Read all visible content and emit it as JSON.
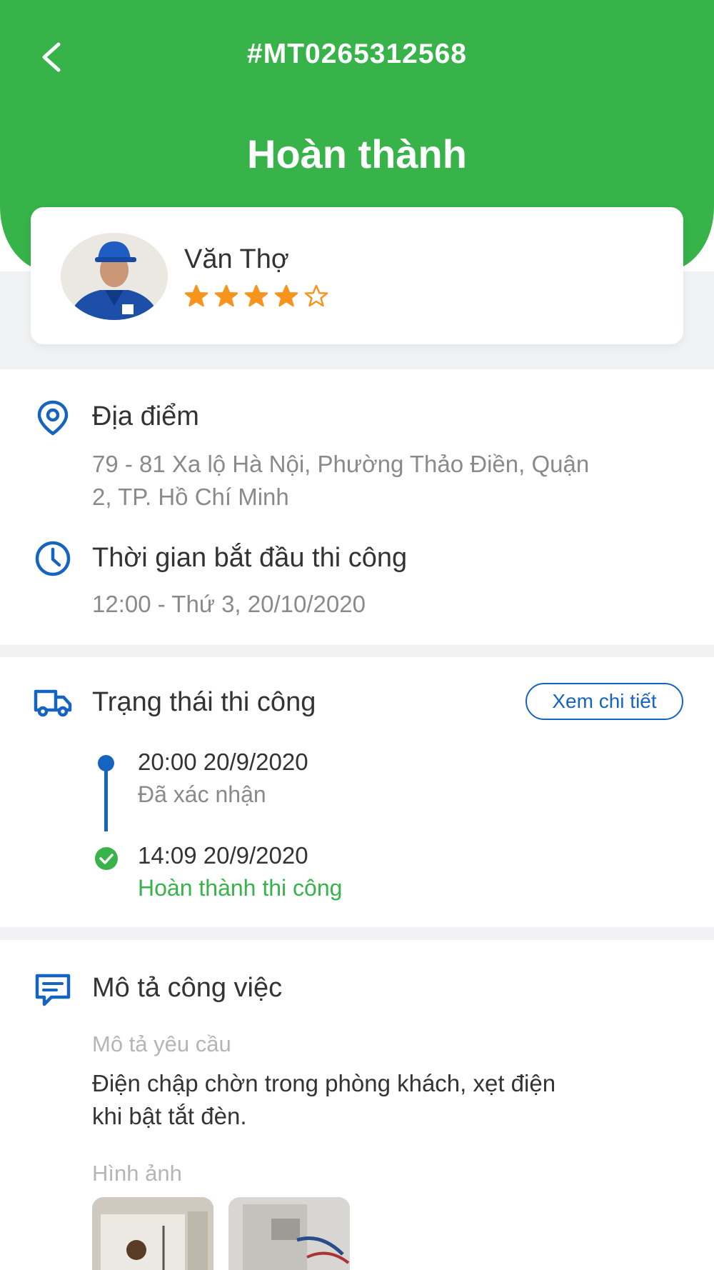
{
  "header": {
    "order_id": "#MT0265312568",
    "status": "Hoàn thành",
    "accent_color": "#37b34a"
  },
  "worker": {
    "name": "Văn Thợ",
    "rating": 4,
    "rating_max": 5
  },
  "location": {
    "title": "Địa điểm",
    "address_line1": "79 - 81 Xa lộ Hà Nội, Phường Thảo Điền, Quận",
    "address_line2": "2, TP. Hồ Chí Minh"
  },
  "start_time": {
    "title": "Thời gian bắt đầu thi công",
    "value": "12:00 - Thứ 3, 20/10/2020"
  },
  "construction_status": {
    "title": "Trạng thái thi công",
    "detail_button": "Xem chi tiết",
    "timeline": [
      {
        "time": "20:00 20/9/2020",
        "label": "Đã xác nhận",
        "color": "#8a8a8a"
      },
      {
        "time": "14:09 20/9/2020",
        "label": "Hoàn thành thi công",
        "color": "#37b34a"
      }
    ]
  },
  "job_description": {
    "title": "Mô tả công việc",
    "request_label": "Mô tả yêu cầu",
    "request_line1": "Điện chập chờn trong phòng khách, xẹt điện",
    "request_line2": "khi bật tắt đèn.",
    "images_label": "Hình ảnh"
  },
  "colors": {
    "primary_blue": "#1565c0",
    "star": "#f7941d"
  }
}
